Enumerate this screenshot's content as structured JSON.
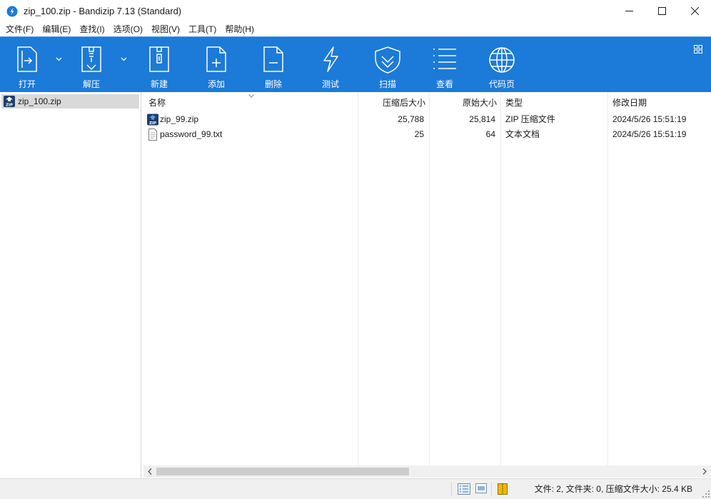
{
  "window": {
    "title": "zip_100.zip - Bandizip 7.13 (Standard)"
  },
  "menu": [
    "文件(F)",
    "编辑(E)",
    "查找(I)",
    "选项(O)",
    "视图(V)",
    "工具(T)",
    "帮助(H)"
  ],
  "toolbar": {
    "open": "打开",
    "extract": "解压",
    "new": "新建",
    "add": "添加",
    "delete": "删除",
    "test": "测试",
    "scan": "扫描",
    "view": "查看",
    "codepage": "代码页"
  },
  "tree": {
    "root": "zip_100.zip"
  },
  "columns": {
    "name": "名称",
    "packed": "压缩后大小",
    "size": "原始大小",
    "type": "类型",
    "modified": "修改日期"
  },
  "files": [
    {
      "name": "zip_99.zip",
      "packed": "25,788",
      "size": "25,814",
      "type": "ZIP 压缩文件",
      "modified": "2024/5/26 15:51:19"
    },
    {
      "name": "password_99.txt",
      "packed": "25",
      "size": "64",
      "type": "文本文档",
      "modified": "2024/5/26 15:51:19"
    }
  ],
  "status": {
    "text": "文件: 2, 文件夹: 0, 压缩文件大小: 25.4 KB"
  },
  "colors": {
    "toolbar": "#1c7ad8",
    "selection": "#d9d9d9",
    "statusbar": "#f0f0f0"
  }
}
